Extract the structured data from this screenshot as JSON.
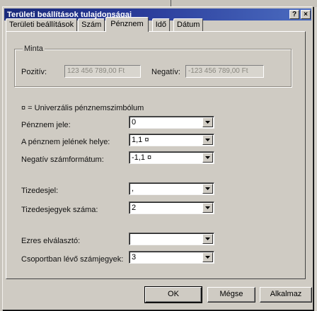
{
  "window": {
    "title": "Területi beállítások tulajdonságai",
    "help_glyph": "?",
    "close_glyph": "×"
  },
  "tabs": [
    {
      "label": "Területi beállítások",
      "active": false
    },
    {
      "label": "Szám",
      "active": false
    },
    {
      "label": "Pénznem",
      "active": true
    },
    {
      "label": "Idő",
      "active": false
    },
    {
      "label": "Dátum",
      "active": false
    }
  ],
  "sample": {
    "group_title": "Minta",
    "positive_label": "Pozitív:",
    "positive_value": "123 456 789,00 Ft",
    "negative_label": "Negatív:",
    "negative_value": "-123 456 789,00 Ft"
  },
  "legend": "¤ = Univerzális pénznemszimbólum",
  "fields": {
    "currency_symbol": {
      "label": "Pénznem jele:",
      "value": "0"
    },
    "symbol_position": {
      "label": "A pénznem jelének helye:",
      "value": "1,1 ¤"
    },
    "negative_format": {
      "label": "Negatív számformátum:",
      "value": "-1,1 ¤"
    },
    "decimal_symbol": {
      "label": "Tizedesjel:",
      "value": ","
    },
    "decimal_digits": {
      "label": "Tizedesjegyek száma:",
      "value": "2"
    },
    "digit_grouping_symbol": {
      "label": "Ezres elválasztó:",
      "value": ""
    },
    "digits_in_group": {
      "label": "Csoportban lévő számjegyek:",
      "value": "3"
    }
  },
  "buttons": {
    "ok": "OK",
    "cancel": "Mégse",
    "apply": "Alkalmaz"
  },
  "colors": {
    "titlebar_start": "#1a2a7a",
    "titlebar_end": "#4b6cc0",
    "dialog_face": "#cfcbc3"
  }
}
